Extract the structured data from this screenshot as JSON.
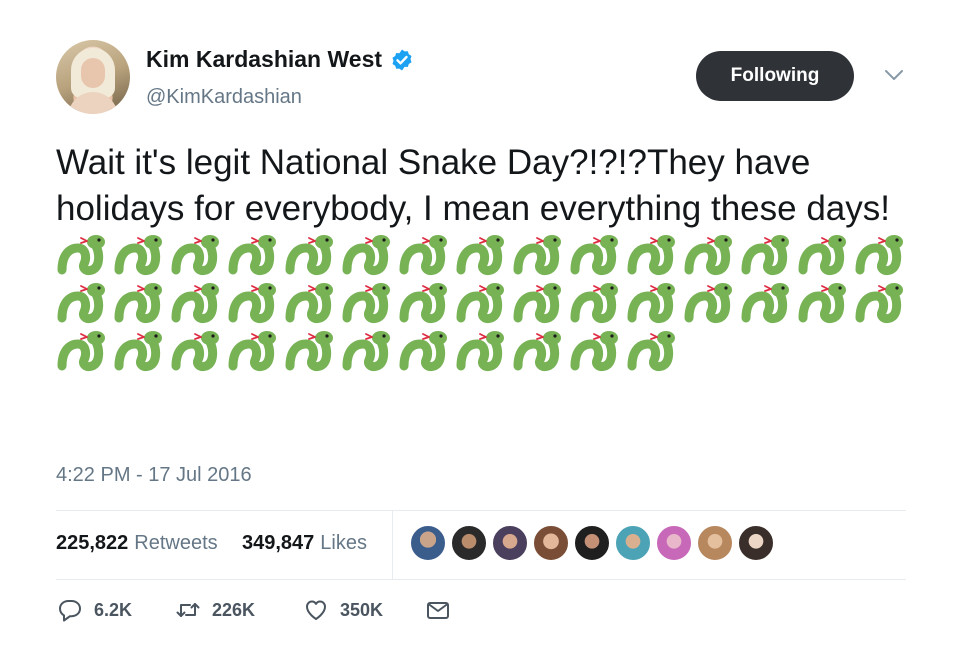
{
  "user": {
    "display_name": "Kim Kardashian West",
    "handle": "@KimKardashian",
    "verified": true,
    "avatar_icon": "profile-photo"
  },
  "follow_button": {
    "label": "Following"
  },
  "menu_icon": "chevron-down-icon",
  "tweet": {
    "text": "Wait it's legit National Snake Day?!?!?They have holidays for everybody, I mean everything these days!",
    "emoji": "🐍",
    "emoji_count": 41,
    "timestamp": "4:22 PM - 17 Jul 2016"
  },
  "stats": {
    "retweets_count": "225,822",
    "retweets_label": "Retweets",
    "likes_count": "349,847",
    "likes_label": "Likes",
    "liker_avatars": 9
  },
  "actions": {
    "reply_count": "6.2K",
    "retweet_count": "226K",
    "like_count": "350K"
  },
  "colors": {
    "text": "#14171a",
    "secondary": "#657786",
    "verified_blue": "#1da1f2",
    "button_dark": "#2f3337",
    "snake_green": "#77b255",
    "divider": "#e6ecf0"
  }
}
